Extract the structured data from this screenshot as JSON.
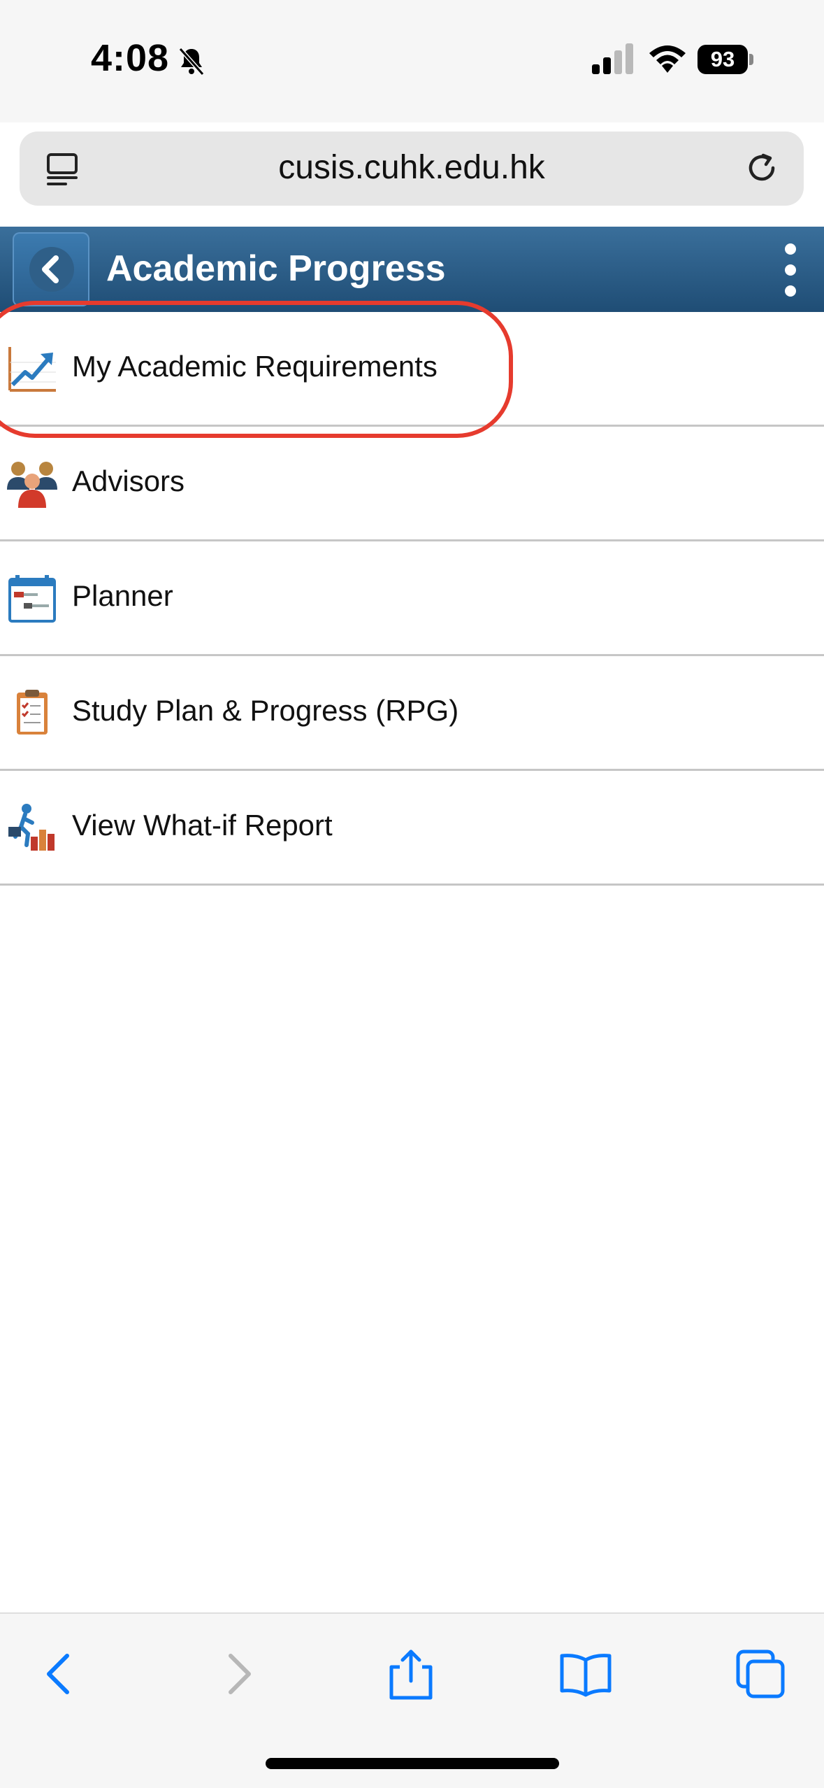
{
  "status": {
    "time": "4:08",
    "battery": "93"
  },
  "browser": {
    "url": "cusis.cuhk.edu.hk"
  },
  "header": {
    "title": "Academic Progress"
  },
  "menu": [
    {
      "label": "My Academic Requirements",
      "icon": "chart-trend-icon",
      "highlighted": true
    },
    {
      "label": "Advisors",
      "icon": "advisors-icon"
    },
    {
      "label": "Planner",
      "icon": "calendar-planner-icon"
    },
    {
      "label": "Study Plan & Progress (RPG)",
      "icon": "clipboard-checklist-icon"
    },
    {
      "label": "View What-if Report",
      "icon": "what-if-report-icon"
    }
  ],
  "colors": {
    "header": "#2b5c86",
    "accent": "#0a7aff",
    "highlight": "#e63b2e"
  }
}
